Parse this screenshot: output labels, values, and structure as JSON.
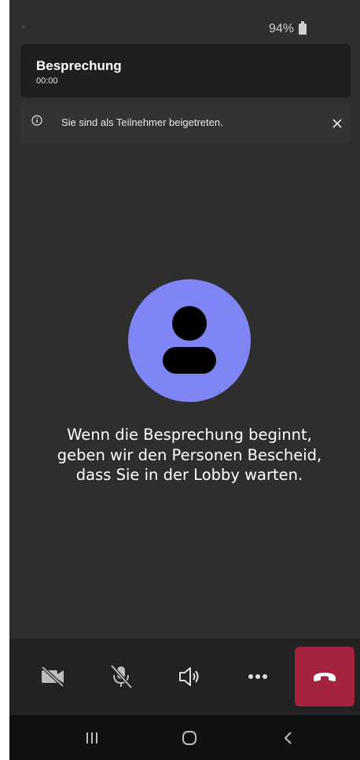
{
  "status_bar": {
    "battery": "94%"
  },
  "meeting": {
    "title": "Besprechung",
    "duration": "00:00"
  },
  "notice": {
    "text": "Sie sind als Teilnehmer beigetreten."
  },
  "lobby": {
    "lines": [
      "Wenn die Besprechung beginnt,",
      "geben wir den Personen Bescheid,",
      "dass Sie in der Lobby warten."
    ]
  },
  "controls": {
    "camera_icon": "camera-off-icon",
    "mic_icon": "mic-off-icon",
    "speaker_icon": "speaker-icon",
    "more_icon": "more-options-icon",
    "hangup_icon": "hang-up-icon"
  },
  "colors": {
    "avatar": "#7f85f5",
    "hangup": "#a4233f",
    "background": "#2e2e2e"
  }
}
